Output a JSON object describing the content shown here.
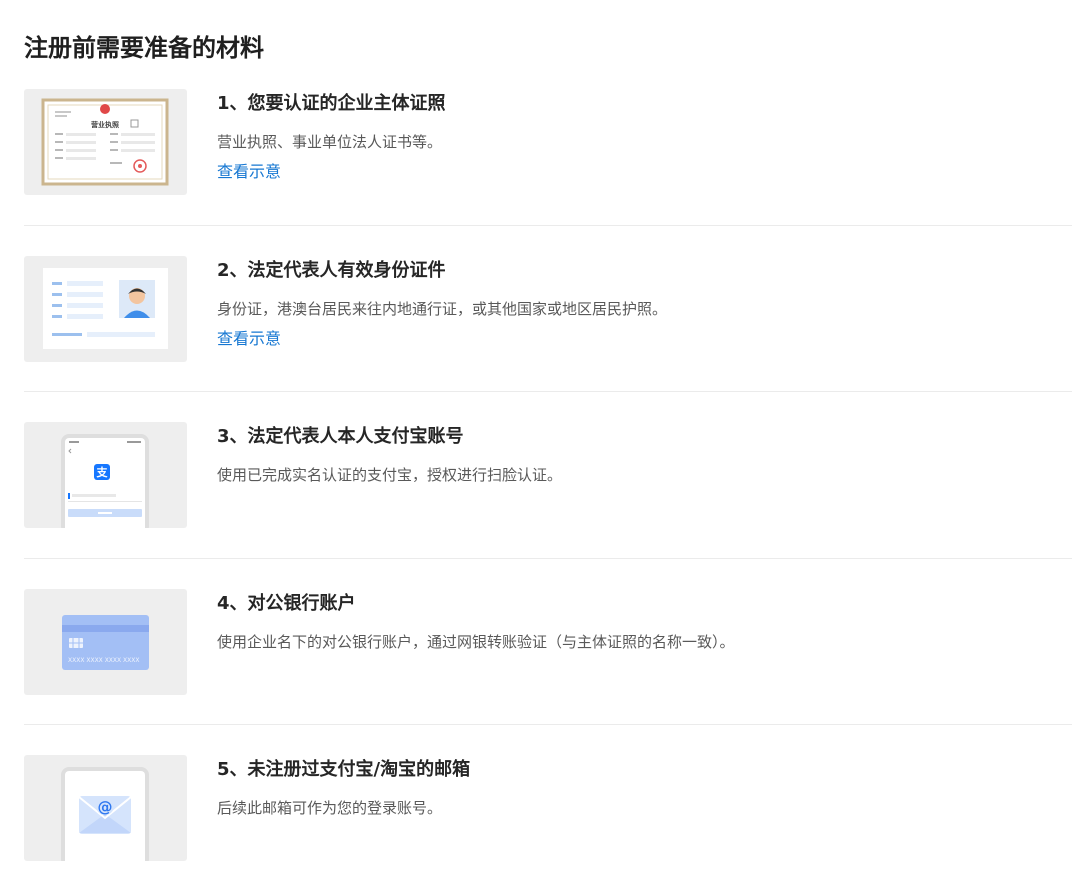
{
  "page": {
    "title": "注册前需要准备的材料"
  },
  "items": [
    {
      "title": "1、您要认证的企业主体证照",
      "desc": "营业执照、事业单位法人证书等。",
      "link": "查看示意",
      "thumb": "business-license-illustration",
      "thumb_text": "营业执照"
    },
    {
      "title": "2、法定代表人有效身份证件",
      "desc": "身份证，港澳台居民来往内地通行证，或其他国家或地区居民护照。",
      "link": "查看示意",
      "thumb": "id-card-illustration"
    },
    {
      "title": "3、法定代表人本人支付宝账号",
      "desc": "使用已完成实名认证的支付宝，授权进行扫脸认证。",
      "thumb": "alipay-phone-illustration",
      "thumb_text": "支"
    },
    {
      "title": "4、对公银行账户",
      "desc": "使用企业名下的对公银行账户，通过网银转账验证（与主体证照的名称一致）。",
      "thumb": "bank-card-illustration",
      "thumb_text": "XXXX XXXX XXXX XXXX"
    },
    {
      "title": "5、未注册过支付宝/淘宝的邮箱",
      "desc": "后续此邮箱可作为您的登录账号。",
      "thumb": "email-envelope-illustration",
      "thumb_text": "@"
    }
  ]
}
